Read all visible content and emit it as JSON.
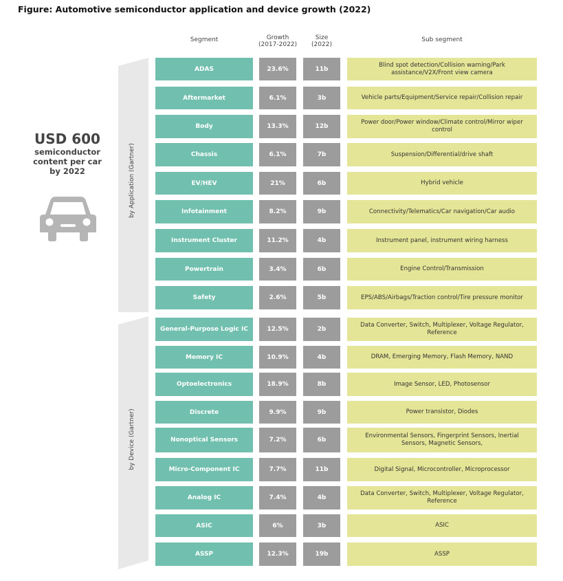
{
  "title": "Figure: Automotive semiconductor application and device growth (2022)",
  "headers": {
    "segment": "Segment",
    "growth_line1": "Growth",
    "growth_line2": "(2017-2022)",
    "size_line1": "Size",
    "size_line2": "(2022)",
    "subsegment": "Sub segment"
  },
  "callout": {
    "amount": "USD 600",
    "line1": "semiconductor",
    "line2": "content per car",
    "line3": "by 2022"
  },
  "groups": {
    "application": "by Application    (Gartner)",
    "device": "by Device  (Gartner)"
  },
  "rows": [
    {
      "segment": "ADAS",
      "growth": "23.6%",
      "size": "11b",
      "sub": "Blind spot detection/Collision warning/Park assistance/V2X/Front view camera"
    },
    {
      "segment": "Aftermarket",
      "growth": "6.1%",
      "size": "3b",
      "sub": "Vehicle parts/Equipment/Service repair/Collision repair"
    },
    {
      "segment": "Body",
      "growth": "13.3%",
      "size": "12b",
      "sub": "Power door/Power window/Climate  control/Mirror wiper control"
    },
    {
      "segment": "Chassis",
      "growth": "6.1%",
      "size": "7b",
      "sub": "Suspension/Differential/drive shaft"
    },
    {
      "segment": "EV/HEV",
      "growth": "21%",
      "size": "6b",
      "sub": "Hybrid vehicle"
    },
    {
      "segment": "Infotainment",
      "growth": "8.2%",
      "size": "9b",
      "sub": "Connectivity/Telematics/Car navigation/Car audio"
    },
    {
      "segment": "Instrument Cluster",
      "growth": "11.2%",
      "size": "4b",
      "sub": "Instrument panel, instrument wiring harness"
    },
    {
      "segment": "Powertrain",
      "growth": "3.4%",
      "size": "6b",
      "sub": "Engine Control/Transmission"
    },
    {
      "segment": "Safety",
      "growth": "2.6%",
      "size": "5b",
      "sub": "EPS/ABS/Airbags/Traction control/Tire pressure monitor"
    },
    {
      "segment": "General-Purpose Logic IC",
      "growth": "12.5%",
      "size": "2b",
      "sub": "Data Converter, Switch, Multiplexer, Voltage Regulator, Reference"
    },
    {
      "segment": "Memory IC",
      "growth": "10.9%",
      "size": "4b",
      "sub": "DRAM, Emerging Memory, Flash Memory, NAND"
    },
    {
      "segment": "Optoelectronics",
      "growth": "18.9%",
      "size": "8b",
      "sub": "Image Sensor, LED, Photosensor"
    },
    {
      "segment": "Discrete",
      "growth": "9.9%",
      "size": "9b",
      "sub": "Power transistor, Diodes"
    },
    {
      "segment": "Nonoptical Sensors",
      "growth": "7.2%",
      "size": "6b",
      "sub": "Environmental Sensors, Fingerprint Sensors, Inertial Sensors, Magnetic Sensors,"
    },
    {
      "segment": "Micro-Component IC",
      "growth": "7.7%",
      "size": "11b",
      "sub": "Digital Signal, Microcontroller, Microprocessor"
    },
    {
      "segment": "Analog IC",
      "growth": "7.4%",
      "size": "4b",
      "sub": "Data Converter, Switch, Multiplexer, Voltage Regulator, Reference"
    },
    {
      "segment": "ASIC",
      "growth": "6%",
      "size": "3b",
      "sub": "ASIC"
    },
    {
      "segment": "ASSP",
      "growth": "12.3%",
      "size": "19b",
      "sub": "ASSP"
    }
  ],
  "colors": {
    "segment": "#71bfae",
    "value": "#9c9c9c",
    "subsegment": "#e5e597",
    "bracket": "#e8e8e8"
  },
  "icons": {
    "car": "car-icon"
  }
}
